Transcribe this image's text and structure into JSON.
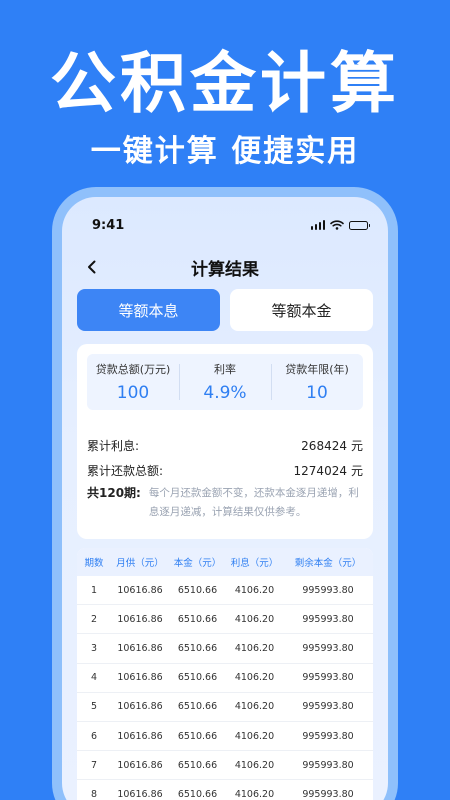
{
  "hero": {
    "title": "公积金计算",
    "subtitle": "一键计算 便捷实用"
  },
  "status_bar": {
    "time": "9:41"
  },
  "nav": {
    "title": "计算结果"
  },
  "tabs": [
    {
      "label": "等额本息",
      "active": true
    },
    {
      "label": "等额本金",
      "active": false
    }
  ],
  "metrics": [
    {
      "label": "贷款总额(万元)",
      "value": "100"
    },
    {
      "label": "利率",
      "value": "4.9%"
    },
    {
      "label": "贷款年限(年)",
      "value": "10"
    }
  ],
  "summary": {
    "interest_label": "累计利息:",
    "interest_value": "268424",
    "interest_unit": "元",
    "total_label": "累计还款总额:",
    "total_value": "1274024",
    "total_unit": "元",
    "periods_label": "共120期:",
    "periods_note": "每个月还款金额不变，还款本金逐月递增，利息逐月递减，计算结果仅供参考。"
  },
  "table": {
    "headers": [
      "期数",
      "月供（元）",
      "本金（元）",
      "利息（元）",
      "剩余本金（元）"
    ],
    "rows": [
      [
        "1",
        "10616.86",
        "6510.66",
        "4106.20",
        "995993.80"
      ],
      [
        "2",
        "10616.86",
        "6510.66",
        "4106.20",
        "995993.80"
      ],
      [
        "3",
        "10616.86",
        "6510.66",
        "4106.20",
        "995993.80"
      ],
      [
        "4",
        "10616.86",
        "6510.66",
        "4106.20",
        "995993.80"
      ],
      [
        "5",
        "10616.86",
        "6510.66",
        "4106.20",
        "995993.80"
      ],
      [
        "6",
        "10616.86",
        "6510.66",
        "4106.20",
        "995993.80"
      ],
      [
        "7",
        "10616.86",
        "6510.66",
        "4106.20",
        "995993.80"
      ],
      [
        "8",
        "10616.86",
        "6510.66",
        "4106.20",
        "995993.80"
      ]
    ]
  },
  "colors": {
    "background": "#2f80f6",
    "accent": "#3d85f5",
    "value_blue": "#2f7ff2"
  }
}
